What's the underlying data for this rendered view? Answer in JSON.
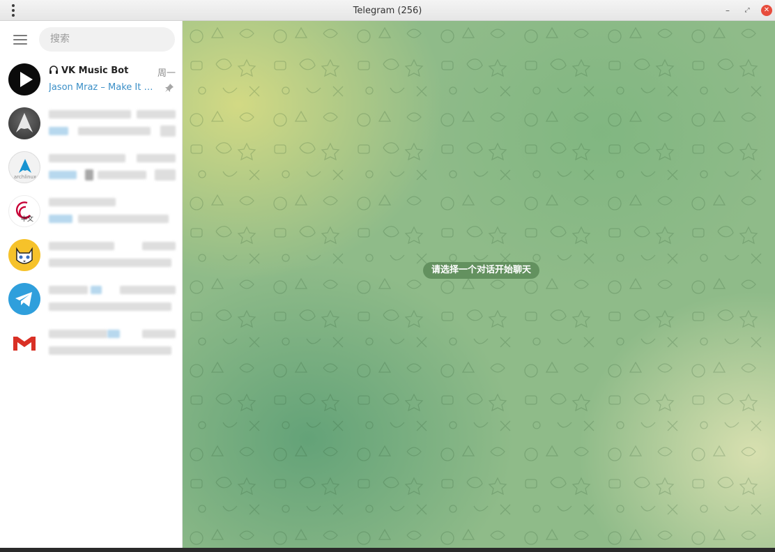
{
  "window": {
    "title": "Telegram (256)",
    "controls": {
      "minimize_icon": "minimize-icon",
      "maximize_icon": "maximize-icon",
      "close_icon": "close-icon",
      "close_color": "#e74c3c"
    }
  },
  "sidebar": {
    "search_placeholder": "搜索",
    "chats": [
      {
        "name": "VK Music Bot",
        "date": "周一",
        "preview": "Jason Mraz – Make It Mine",
        "pinned": true,
        "avatar_icon": "play-logo-icon",
        "name_icon": "headphones-icon"
      },
      {
        "name": "",
        "date": "",
        "preview": "",
        "avatar_icon": "arch-logo-icon"
      },
      {
        "name": "",
        "date": "",
        "preview": "",
        "avatar_icon": "archlinux-cn-logo-icon"
      },
      {
        "name": "",
        "date": "",
        "preview": "",
        "avatar_icon": "debian-logo-icon",
        "avatar_text": "中文"
      },
      {
        "name": "",
        "date": "",
        "preview": "",
        "avatar_icon": "cat-avatar-icon"
      },
      {
        "name": "",
        "date": "",
        "preview": "",
        "avatar_icon": "telegram-logo-icon"
      },
      {
        "name": "",
        "date": "",
        "preview": "",
        "avatar_icon": "gmail-logo-icon"
      }
    ]
  },
  "main": {
    "empty_hint": "请选择一个对话开始聊天"
  },
  "colors": {
    "accent": "#3a8fc7",
    "hint_bg": "#5c8a58",
    "telegram_blue": "#2f9fdc"
  }
}
